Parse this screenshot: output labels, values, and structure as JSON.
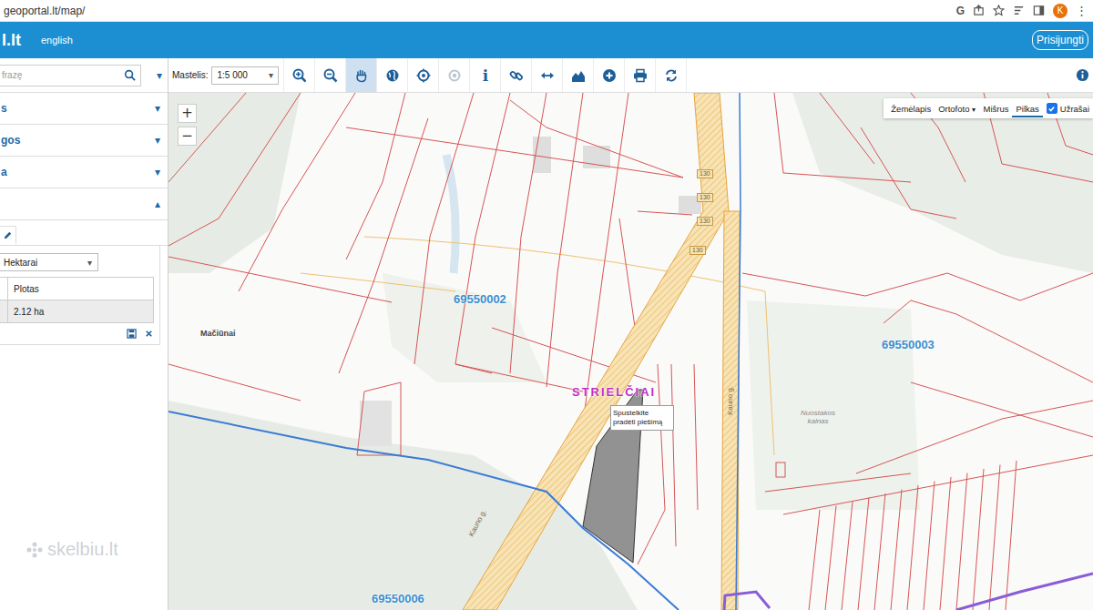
{
  "browser": {
    "url": "geoportal.lt/map/",
    "google": "G",
    "avatar": "K",
    "menu": "⋮"
  },
  "header": {
    "logo": "l.lt",
    "language": "english",
    "login": "Prisijungti"
  },
  "search": {
    "placeholder": "frazę",
    "toggle": "▾"
  },
  "toolbar": {
    "scale_label": "Mastelis:",
    "scale_value": "1:5 000",
    "scale_caret": "▾",
    "tools": [
      {
        "kind": "zoom-in",
        "selected": false,
        "disabled": false
      },
      {
        "kind": "zoom-out",
        "selected": false,
        "disabled": false
      },
      {
        "kind": "pan",
        "selected": true,
        "disabled": false
      },
      {
        "kind": "globe",
        "selected": false,
        "disabled": false
      },
      {
        "kind": "target",
        "selected": false,
        "disabled": false
      },
      {
        "kind": "locate",
        "selected": false,
        "disabled": true
      },
      {
        "kind": "info",
        "selected": false,
        "disabled": false,
        "glyph": "i"
      },
      {
        "kind": "link",
        "selected": false,
        "disabled": false
      },
      {
        "kind": "measure",
        "selected": false,
        "disabled": false
      },
      {
        "kind": "profile",
        "selected": false,
        "disabled": false
      },
      {
        "kind": "add",
        "selected": false,
        "disabled": false
      },
      {
        "kind": "print",
        "selected": false,
        "disabled": false
      },
      {
        "kind": "refresh",
        "selected": false,
        "disabled": false
      }
    ]
  },
  "sidebar": {
    "sections": [
      {
        "label": "s",
        "expanded": false,
        "toggle": "▾"
      },
      {
        "label": "gos",
        "expanded": false,
        "toggle": "▾"
      },
      {
        "label": "a",
        "expanded": false,
        "toggle": "▾"
      },
      {
        "label": "",
        "expanded": true,
        "toggle": "▴"
      }
    ]
  },
  "measure": {
    "unit": "Hektarai",
    "unit_caret": "▾",
    "columns": [
      "Plotas"
    ],
    "rows": [
      [
        "2.12 ha"
      ]
    ]
  },
  "map": {
    "zoom": [
      "+",
      "−"
    ],
    "layers": [
      {
        "label": "Žemėlapis",
        "selected": false,
        "caret": ""
      },
      {
        "label": "Ortofoto",
        "selected": false,
        "caret": "▾"
      },
      {
        "label": "Mišrus",
        "selected": false,
        "caret": ""
      },
      {
        "label": "Pilkas",
        "selected": true,
        "caret": ""
      }
    ],
    "labels_toggle": {
      "label": "Užrašai",
      "checked": true
    },
    "labels": [
      {
        "text": "69550002",
        "kind": "cadastre"
      },
      {
        "text": "69550003",
        "kind": "cadastre"
      },
      {
        "text": "69550006",
        "kind": "cadastre"
      },
      {
        "text": "STRIELČIAI",
        "kind": "village"
      },
      {
        "text": "Mačiūnai",
        "kind": "place"
      },
      {
        "text": "Nuostakos kalnas",
        "kind": "hill"
      },
      {
        "text": "130",
        "kind": "road-number"
      },
      {
        "text": "130",
        "kind": "road-number"
      },
      {
        "text": "130",
        "kind": "road-number"
      },
      {
        "text": "130",
        "kind": "road-number"
      },
      {
        "text": "Kauno g.",
        "kind": "street"
      },
      {
        "text": "Kauno g.",
        "kind": "street"
      }
    ],
    "tooltip": "Spustelkite pradėti piešimą",
    "watermark": "skelbiu.lt"
  }
}
